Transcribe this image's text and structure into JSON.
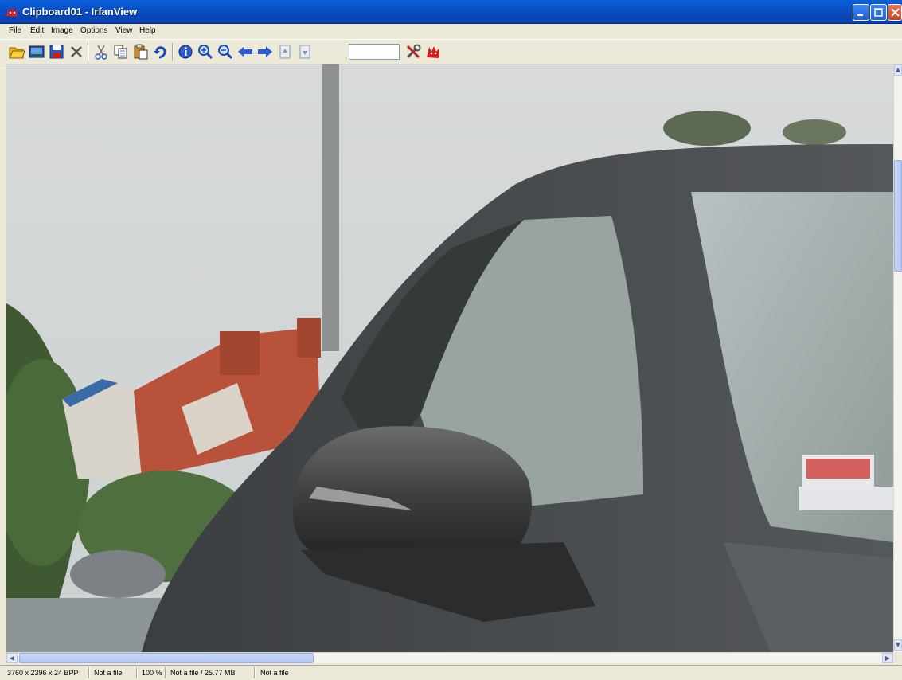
{
  "window": {
    "title": "Clipboard01 - IrfanView",
    "icon": "irfanview-cat-icon"
  },
  "menu": [
    "File",
    "Edit",
    "Image",
    "Options",
    "View",
    "Help"
  ],
  "toolbar": {
    "buttons": [
      "open-icon",
      "slideshow-icon",
      "save-icon",
      "delete-icon",
      "cut-icon",
      "copy-icon",
      "paste-icon",
      "undo-icon",
      "info-icon",
      "zoom-in-icon",
      "zoom-out-icon",
      "previous-icon",
      "next-icon",
      "first-page-icon",
      "last-page-icon",
      "options-icon",
      "irfanview-cat-icon"
    ],
    "zoom_input_value": ""
  },
  "status": {
    "dimensions": "3760 x 2396 x 24 BPP",
    "file_status": "Not a file",
    "zoom": "100 %",
    "file_size": "Not a file / 25.77 MB",
    "file_date": "Not a file"
  },
  "colors": {
    "titlebar": "#0a4ec4",
    "window_bg": "#ece9d8",
    "sky": "#d3d6d7",
    "car_body": "#4b4e51",
    "roof": "#b8523a"
  }
}
